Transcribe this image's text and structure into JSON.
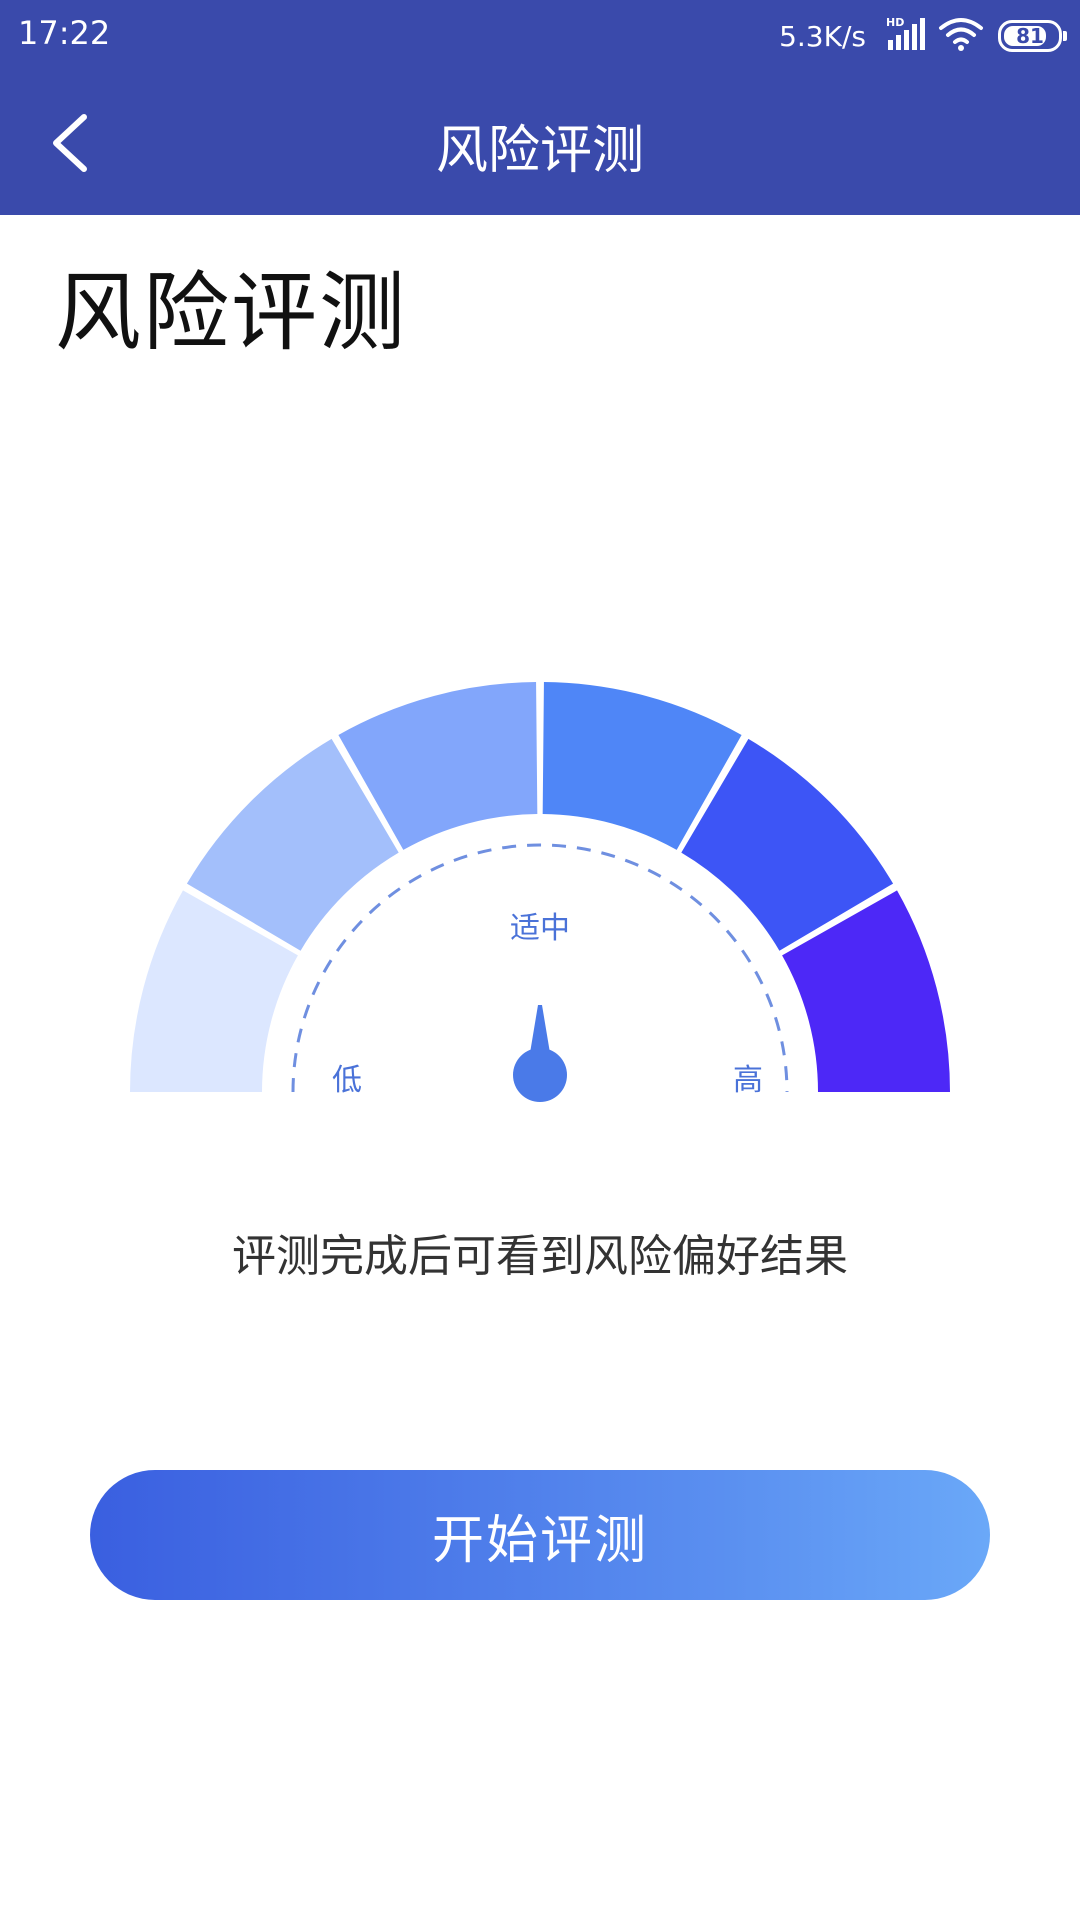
{
  "status_bar": {
    "time": "17:22",
    "net_speed": "5.3K/s",
    "network_type": "HD",
    "battery_level": "81",
    "icons": [
      "signal-icon",
      "wifi-icon",
      "battery-icon"
    ]
  },
  "nav": {
    "title": "风险评测",
    "back_icon": "chevron-left-icon"
  },
  "page": {
    "title": "风险评测"
  },
  "gauge": {
    "segment_colors": [
      "#dce7ff",
      "#a3bffb",
      "#82a6fb",
      "#4f86f7",
      "#3d55f6",
      "#4d28f7"
    ],
    "label_low": "低",
    "label_mid": "适中",
    "label_high": "高",
    "label_color": "#4a72d8",
    "needle_color": "#4a7ae8"
  },
  "hint": "评测完成后可看到风险偏好结果",
  "start_button": {
    "label": "开始评测"
  },
  "colors": {
    "appbar": "#3a4aab",
    "button_gradient_start": "#3a5fe0",
    "button_gradient_end": "#6aa8f8"
  }
}
